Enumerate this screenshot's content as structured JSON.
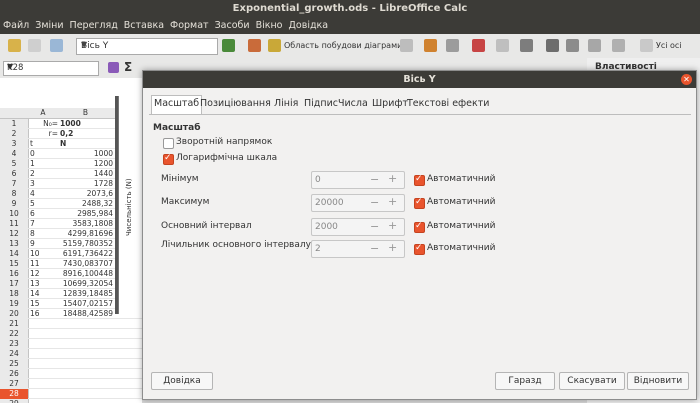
{
  "window": {
    "title": "Exponential_growth.ods - LibreOffice Calc"
  },
  "menu": [
    "Файл",
    "Зміни",
    "Перегляд",
    "Вставка",
    "Формат",
    "Засоби",
    "Вікно",
    "Довідка"
  ],
  "toolbar": {
    "element_select": "Вісь Y",
    "chart_area_label": "Область побудови діаграми",
    "all_label": "Усі осі"
  },
  "formula_bar": {
    "name_box": "K28",
    "sum_symbol": "Σ"
  },
  "sheet": {
    "columns": [
      "A",
      "B"
    ],
    "rows": [
      {
        "n": "1",
        "a": "N₀=",
        "b": "1000"
      },
      {
        "n": "2",
        "a": "r=",
        "b": "0,2"
      },
      {
        "n": "3",
        "a": "t",
        "b": "N"
      },
      {
        "n": "4",
        "a": "0",
        "b": "1000"
      },
      {
        "n": "5",
        "a": "1",
        "b": "1200"
      },
      {
        "n": "6",
        "a": "2",
        "b": "1440"
      },
      {
        "n": "7",
        "a": "3",
        "b": "1728"
      },
      {
        "n": "8",
        "a": "4",
        "b": "2073,6"
      },
      {
        "n": "9",
        "a": "5",
        "b": "2488,32"
      },
      {
        "n": "10",
        "a": "6",
        "b": "2985,984"
      },
      {
        "n": "11",
        "a": "7",
        "b": "3583,1808"
      },
      {
        "n": "12",
        "a": "8",
        "b": "4299,81696"
      },
      {
        "n": "13",
        "a": "9",
        "b": "5159,780352"
      },
      {
        "n": "14",
        "a": "10",
        "b": "6191,736422"
      },
      {
        "n": "15",
        "a": "11",
        "b": "7430,083707"
      },
      {
        "n": "16",
        "a": "12",
        "b": "8916,100448"
      },
      {
        "n": "17",
        "a": "13",
        "b": "10699,32054"
      },
      {
        "n": "18",
        "a": "14",
        "b": "12839,18485"
      },
      {
        "n": "19",
        "a": "15",
        "b": "15407,02157"
      },
      {
        "n": "20",
        "a": "16",
        "b": "18488,42589"
      },
      {
        "n": "21",
        "a": "",
        "b": ""
      },
      {
        "n": "22",
        "a": "",
        "b": ""
      },
      {
        "n": "23",
        "a": "",
        "b": ""
      },
      {
        "n": "24",
        "a": "",
        "b": ""
      },
      {
        "n": "25",
        "a": "",
        "b": ""
      },
      {
        "n": "26",
        "a": "",
        "b": ""
      },
      {
        "n": "27",
        "a": "",
        "b": ""
      },
      {
        "n": "28",
        "a": "",
        "b": ""
      },
      {
        "n": "29",
        "a": "",
        "b": ""
      }
    ],
    "chart_axis_label": "Чисельність (N)",
    "selected_row": "28"
  },
  "dialog": {
    "title": "Вісь Y",
    "tabs": [
      "Масштаб",
      "Позиціювання",
      "Лінія",
      "Підпис",
      "Числа",
      "Шрифт",
      "Текстові ефекти"
    ],
    "active_tab": "Масштаб",
    "section_title": "Масштаб",
    "reverse_label": "Зворотній напрямок",
    "reverse_checked": false,
    "log_label": "Логарифмічна шкала",
    "log_checked": true,
    "fields": [
      {
        "label": "Мінімум",
        "value": "0",
        "auto_label": "Автоматичний",
        "auto": true
      },
      {
        "label": "Максимум",
        "value": "20000",
        "auto_label": "Автоматичний",
        "auto": true
      },
      {
        "label": "Основний інтервал",
        "value": "2000",
        "auto_label": "Автоматичний",
        "auto": true
      },
      {
        "label": "Лічильник основного інтервалу",
        "value": "2",
        "auto_label": "Автоматичний",
        "auto": true
      }
    ],
    "buttons": {
      "help": "Довідка",
      "ok": "Гаразд",
      "cancel": "Скасувати",
      "reset": "Відновити"
    },
    "spin_minus": "−",
    "spin_plus": "+"
  },
  "sidebar": {
    "title": "Властивості"
  },
  "colors": {
    "accent": "#e9542d",
    "titlebar": "#3c3b37",
    "selected_row": "#e9542d"
  }
}
